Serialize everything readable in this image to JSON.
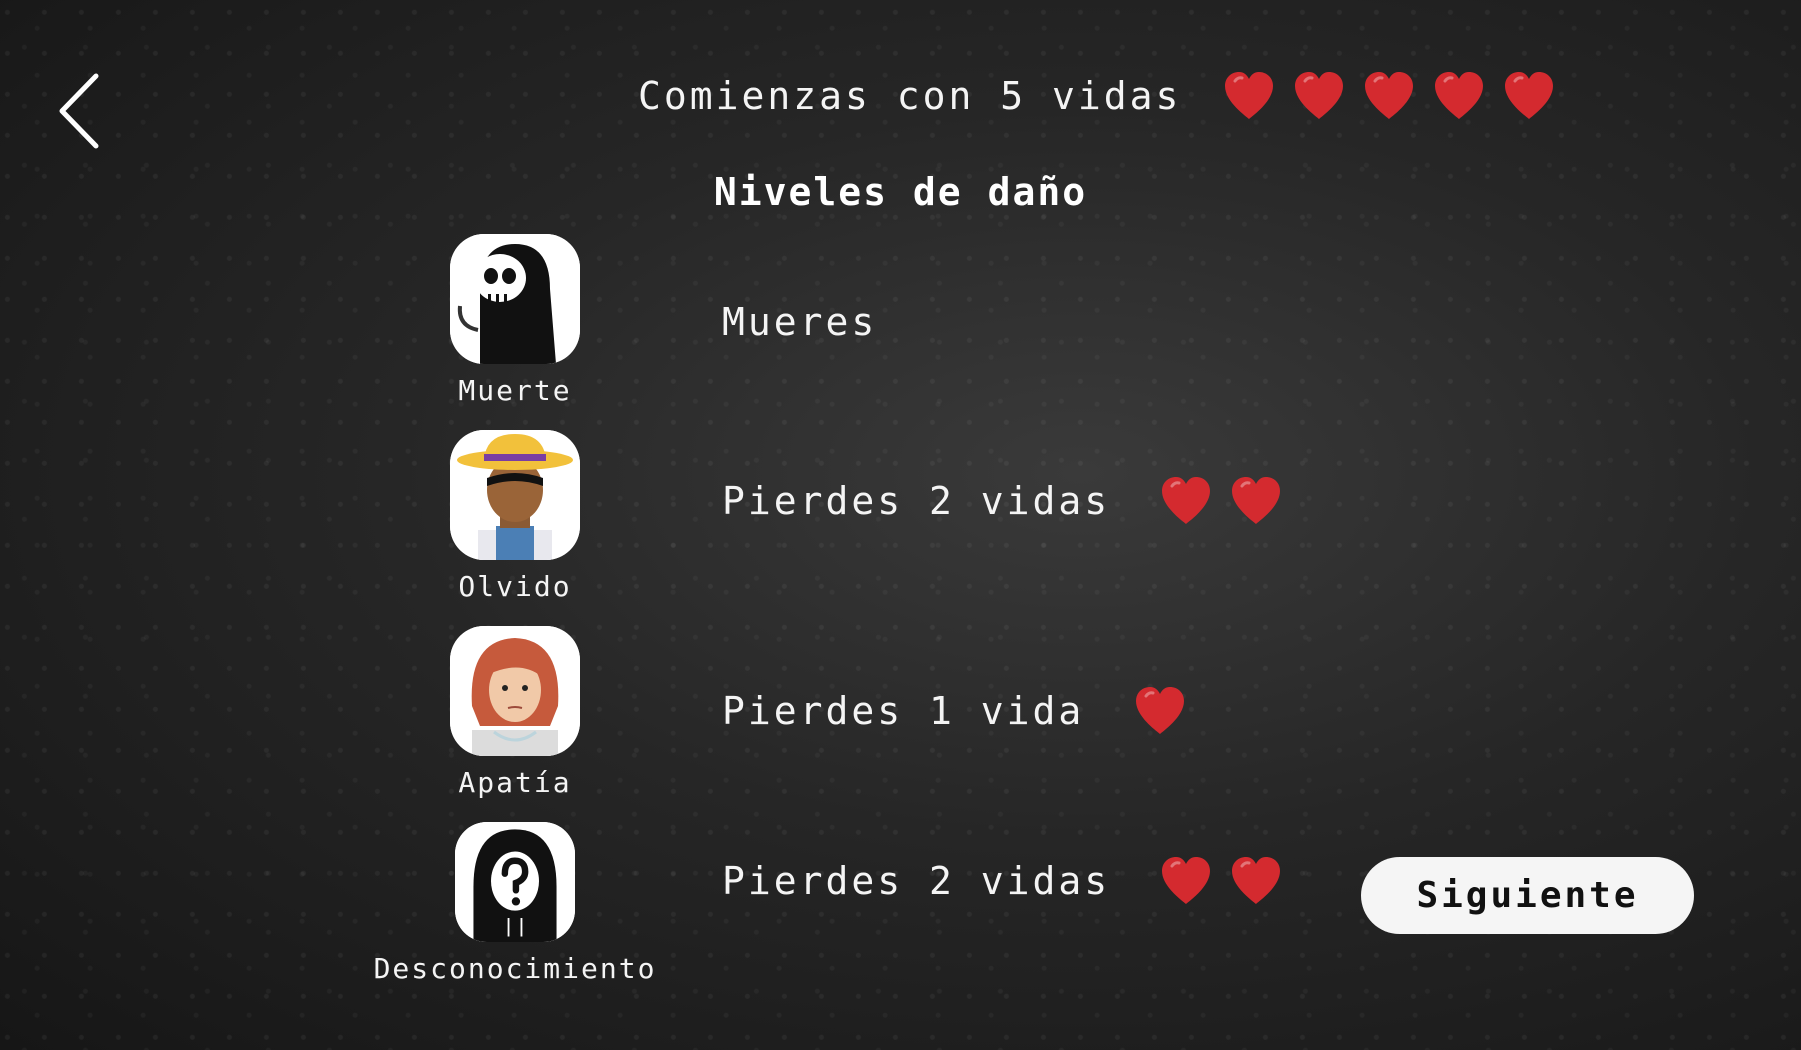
{
  "header": {
    "back_icon": "chevron-left-icon",
    "intro_text": "Comienzas con 5 vidas",
    "starting_lives": 5
  },
  "section_title": "Niveles de daño",
  "damage_levels": [
    {
      "name": "Muerte",
      "effect": "Mueres",
      "lives_lost": 0,
      "avatar_icon": "grim-reaper-icon"
    },
    {
      "name": "Olvido",
      "effect": "Pierdes 2 vidas",
      "lives_lost": 2,
      "avatar_icon": "farmer-icon"
    },
    {
      "name": "Apatía",
      "effect": "Pierdes 1 vida",
      "lives_lost": 1,
      "avatar_icon": "woman-icon"
    },
    {
      "name": "Desconocimiento",
      "effect": "Pierdes 2 vidas",
      "lives_lost": 2,
      "avatar_icon": "hooded-question-icon"
    }
  ],
  "next_button_label": "Siguiente",
  "colors": {
    "heart": "#d42a2f",
    "button_bg": "#f5f5f5",
    "background": "#262626"
  }
}
